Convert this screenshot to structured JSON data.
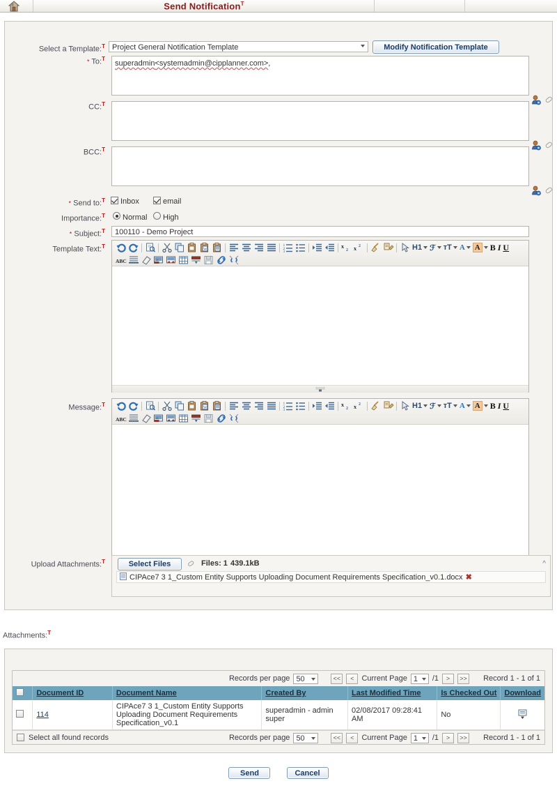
{
  "header": {
    "title": "Send Notification",
    "sup": "T",
    "home_icon": "home-icon"
  },
  "form": {
    "template": {
      "label": "Select a Template:",
      "sup": "T",
      "value": "Project General Notification Template",
      "modify_button": "Modify Notification Template"
    },
    "to": {
      "label": "To:",
      "sup": "T",
      "required": "*",
      "value_name": "superadmin",
      "value_email": "<systemadmin@cipplanner.com>",
      "value_tail": ",",
      "picker_icon": "select-user-icon",
      "clear_icon": "eraser-icon"
    },
    "cc": {
      "label": "CC:",
      "sup": "T",
      "value": "",
      "picker_icon": "select-user-icon",
      "clear_icon": "eraser-icon"
    },
    "bcc": {
      "label": "BCC:",
      "sup": "T",
      "value": "",
      "picker_icon": "select-user-icon",
      "clear_icon": "eraser-icon"
    },
    "send_to": {
      "label": "Send to:",
      "sup": "T",
      "required": "*",
      "options": [
        {
          "label": "Inbox",
          "checked": true
        },
        {
          "label": "email",
          "checked": true
        }
      ]
    },
    "importance": {
      "label": "Importance:",
      "sup": "T",
      "options": [
        {
          "label": "Normal",
          "selected": true
        },
        {
          "label": "High",
          "selected": false
        }
      ]
    },
    "subject": {
      "label": "Subject:",
      "sup": "T",
      "required": "*",
      "value": "100110 - Demo Project"
    },
    "template_text": {
      "label": "Template Text:",
      "sup": "T",
      "body": ""
    },
    "message": {
      "label": "Message:",
      "sup": "T",
      "body": ""
    },
    "upload": {
      "label": "Upload Attachments:",
      "sup": "T",
      "select_files_button": "Select Files",
      "clip_icon": "paperclip-icon",
      "files_count_label": "Files: 1",
      "files_size": "439.1kB",
      "collapse_icon": "chevron-up-icon",
      "file": {
        "icon": "document-icon",
        "name": "CIPAce7 3 1_Custom Entity Supports Uploading Document Requirements Specification_v0.1.docx",
        "remove_icon": "remove-x-icon"
      }
    }
  },
  "editor_toolbar": {
    "row1": [
      {
        "name": "undo-icon",
        "glyph": "undo"
      },
      {
        "name": "redo-icon",
        "glyph": "redo"
      },
      {
        "name": "preview-icon",
        "glyph": "preview"
      },
      {
        "name": "cut-icon",
        "glyph": "cut"
      },
      {
        "name": "copy-icon",
        "glyph": "copy"
      },
      {
        "name": "paste-icon",
        "glyph": "paste"
      },
      {
        "name": "paste-word-icon",
        "glyph": "paste-word"
      },
      {
        "name": "paste-text-icon",
        "glyph": "paste-text"
      },
      {
        "name": "align-left-icon",
        "glyph": "align-left"
      },
      {
        "name": "align-center-icon",
        "glyph": "align-center"
      },
      {
        "name": "align-right-icon",
        "glyph": "align-right"
      },
      {
        "name": "align-justify-icon",
        "glyph": "align-justify"
      },
      {
        "name": "ordered-list-icon",
        "glyph": "ol"
      },
      {
        "name": "unordered-list-icon",
        "glyph": "ul"
      },
      {
        "name": "indent-icon",
        "glyph": "indent"
      },
      {
        "name": "outdent-icon",
        "glyph": "outdent"
      },
      {
        "name": "subscript-icon",
        "glyph": "sub"
      },
      {
        "name": "superscript-icon",
        "glyph": "sup"
      },
      {
        "name": "clear-format-icon",
        "glyph": "broom"
      },
      {
        "name": "format-painter-icon",
        "glyph": "painter"
      },
      {
        "name": "select-icon",
        "glyph": "cursor"
      }
    ],
    "row1_labels": [
      {
        "name": "heading-dropdown",
        "text": "H1"
      },
      {
        "name": "font-dropdown",
        "text": "ℱ"
      },
      {
        "name": "font-size-dropdown",
        "text": "ᴛT"
      },
      {
        "name": "font-color-dropdown",
        "text": "A",
        "kind": "blue"
      },
      {
        "name": "highlight-color-dropdown",
        "text": "A",
        "kind": "highlight"
      },
      {
        "name": "bold-button",
        "text": "B",
        "kind": "bold"
      },
      {
        "name": "italic-button",
        "text": "I",
        "kind": "italic"
      },
      {
        "name": "underline-button",
        "text": "U",
        "kind": "underline"
      }
    ],
    "row2": [
      {
        "name": "spellcheck-icon",
        "glyph": "abc"
      },
      {
        "name": "strikethrough-icon",
        "glyph": "strike"
      },
      {
        "name": "eraser-icon",
        "glyph": "eraser"
      },
      {
        "name": "insert-image-icon",
        "glyph": "image"
      },
      {
        "name": "insert-media-icon",
        "glyph": "media"
      },
      {
        "name": "insert-table-icon",
        "glyph": "table"
      },
      {
        "name": "horizontal-rule-icon",
        "glyph": "hr"
      },
      {
        "name": "save-icon",
        "glyph": "save"
      },
      {
        "name": "insert-link-icon",
        "glyph": "link"
      },
      {
        "name": "unlink-icon",
        "glyph": "unlink"
      }
    ]
  },
  "attachments_section": {
    "label": "Attachments:",
    "sup": "T",
    "pagination": {
      "records_per_page_label": "Records per page",
      "records_per_page_value": "50",
      "first_button": "<<",
      "prev_button": "<",
      "current_page_label": "Current Page",
      "current_page_value": "1",
      "total_pages": "/1",
      "next_button": ">",
      "last_button": ">>",
      "record_range": "Record 1 - 1 of 1"
    },
    "columns": [
      "Document ID",
      "Document Name",
      "Created By",
      "Last Modified Time",
      "Is Checked Out",
      "Download"
    ],
    "rows": [
      {
        "selected": false,
        "document_id": "114",
        "document_name": "CIPAce7 3 1_Custom Entity Supports Uploading Document Requirements Specification_v0.1",
        "created_by": "superadmin - admin super",
        "last_modified_time": "02/08/2017 09:28:41 AM",
        "is_checked_out": "No",
        "download_icon": "download-icon"
      }
    ],
    "select_all_label": "Select all found records"
  },
  "footer": {
    "send_button": "Send",
    "cancel_button": "Cancel"
  },
  "colors": {
    "title_red": "#8c1a1a",
    "required_red": "#b02020",
    "grid_header_blue": "#6fa4bd",
    "link_blue": "#1b3f6b",
    "panel_bg": "#f4f3f0"
  }
}
